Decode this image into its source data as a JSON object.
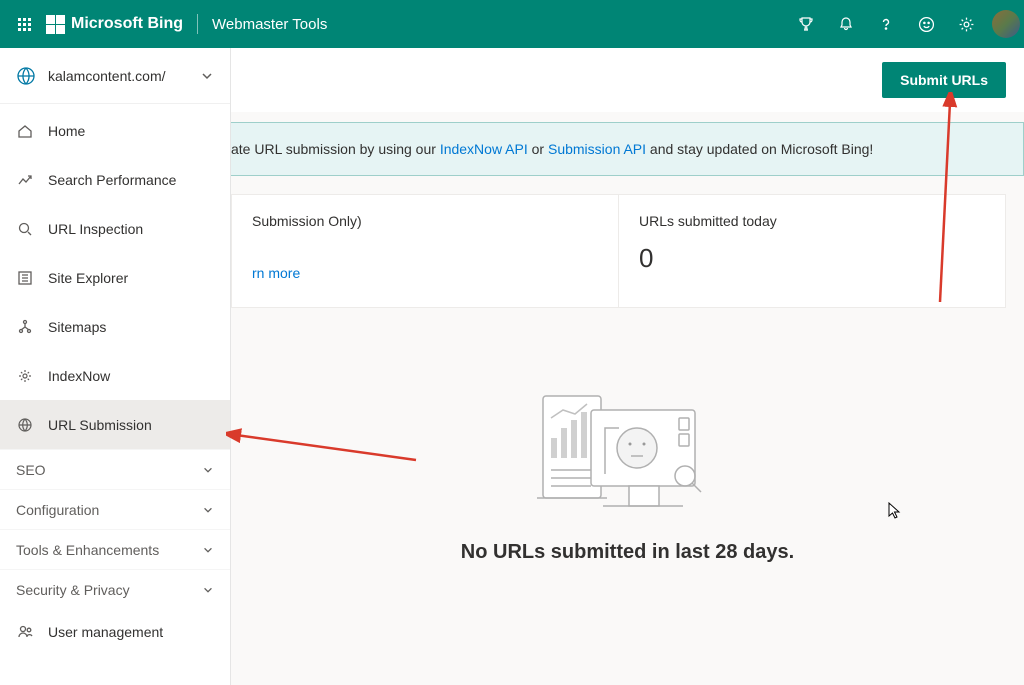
{
  "header": {
    "brand": "Microsoft Bing",
    "tool": "Webmaster Tools"
  },
  "sidebar": {
    "site": "kalamcontent.com/",
    "items": [
      {
        "label": "Home"
      },
      {
        "label": "Search Performance"
      },
      {
        "label": "URL Inspection"
      },
      {
        "label": "Site Explorer"
      },
      {
        "label": "Sitemaps"
      },
      {
        "label": "IndexNow"
      },
      {
        "label": "URL Submission"
      }
    ],
    "groups": [
      {
        "label": "SEO"
      },
      {
        "label": "Configuration"
      },
      {
        "label": "Tools & Enhancements"
      },
      {
        "label": "Security & Privacy"
      }
    ],
    "user_mgmt": "User management"
  },
  "main": {
    "submit_button": "Submit URLs",
    "banner_prefix": "ate URL submission by using our ",
    "banner_link1": "IndexNow API",
    "banner_mid": " or ",
    "banner_link2": "Submission API",
    "banner_suffix": " and stay updated on Microsoft Bing!",
    "card1_title": " Submission Only)",
    "card1_learn": "rn more",
    "card2_title": "URLs submitted today",
    "card2_value": "0",
    "empty_text": "No URLs submitted in last 28 days."
  }
}
